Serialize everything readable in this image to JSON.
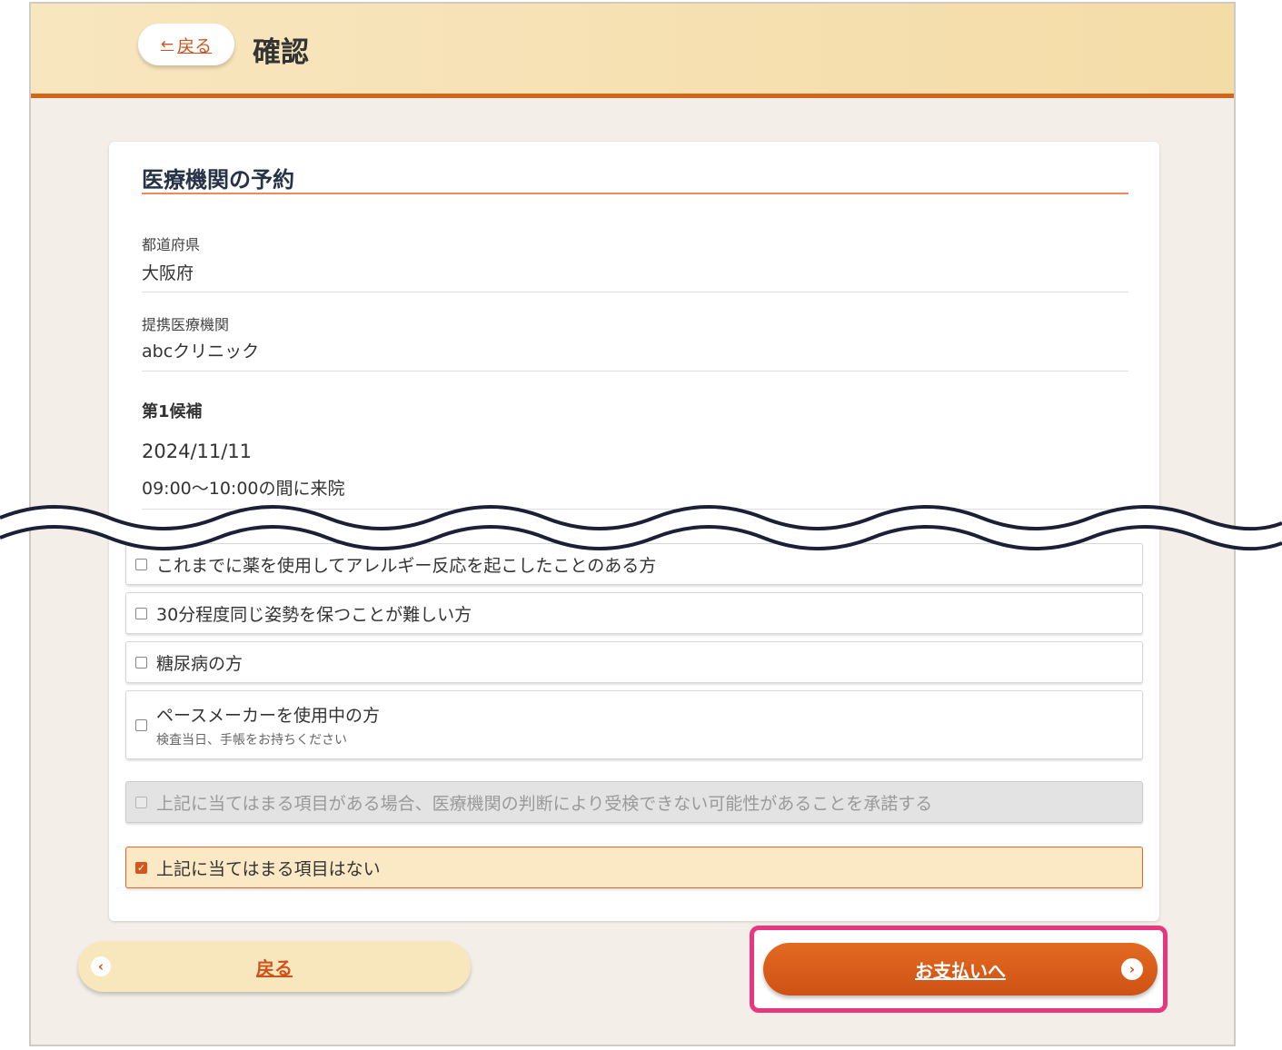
{
  "header": {
    "back_arrow": "←",
    "back_label": "戻る",
    "title": "確認"
  },
  "card": {
    "title": "医療機関の予約",
    "fields": [
      {
        "label": "都道府県",
        "value": "大阪府"
      },
      {
        "label": "提携医療機関",
        "value": "abcクリニック"
      }
    ],
    "candidate": {
      "title": "第1候補",
      "date": "2024/11/11",
      "time": "09:00〜10:00の間に来院"
    },
    "checklist": [
      {
        "label": "これまでに薬を使用してアレルギー反応を起こしたことのある方",
        "checked": false
      },
      {
        "label": "30分程度同じ姿勢を保つことが難しい方",
        "checked": false
      },
      {
        "label": "糖尿病の方",
        "checked": false
      },
      {
        "label": "ペースメーカーを使用中の方",
        "sub": "検査当日、手帳をお持ちください",
        "checked": false
      }
    ],
    "consent": {
      "label": "上記に当てはまる項目がある場合、医療機関の判断により受検できない可能性があることを承諾する",
      "disabled": true,
      "checked": false
    },
    "none_option": {
      "label": "上記に当てはまる項目はない",
      "checked": true,
      "check_glyph": "✓"
    }
  },
  "footer": {
    "back_icon": "‹",
    "back_label": "戻る",
    "pay_label": "お支払いへ",
    "pay_icon": "›"
  },
  "colors": {
    "accent": "#d4561c",
    "header_bg": "#f4dca7",
    "highlight": "#e8377f"
  }
}
